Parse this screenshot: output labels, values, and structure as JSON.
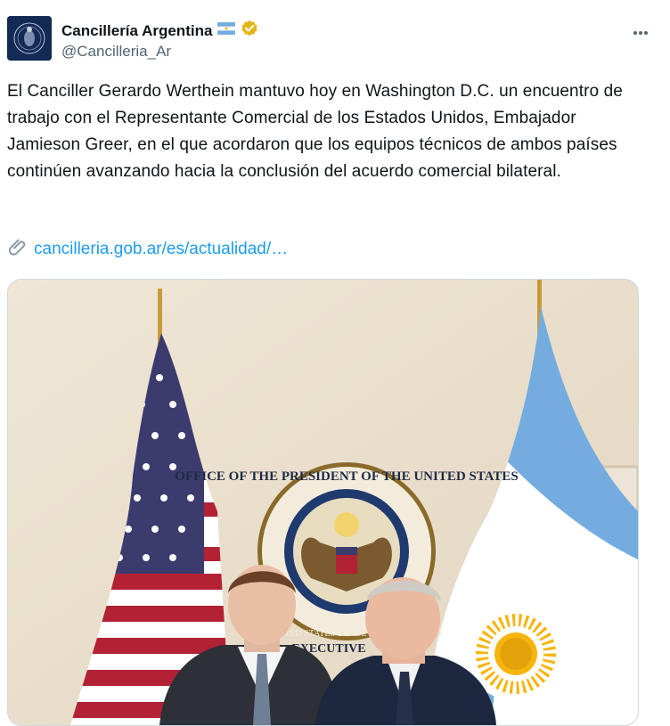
{
  "account": {
    "display_name": "Cancillería Argentina",
    "handle": "@Cancilleria_Ar",
    "flag_icon": "argentina-flag-icon",
    "verified_icon": "gold-verified-badge-icon",
    "verified_color": "#e2b719"
  },
  "tweet": {
    "text": "El Canciller Gerardo Werthein mantuvo hoy en Washington D.C. un encuentro de trabajo con el Representante Comercial de los Estados Unidos, Embajador Jamieson Greer, en el que acordaron que los equipos técnicos de ambos países continúen avanzando hacia la conclusión del acuerdo comercial bilateral.",
    "link_icon": "paperclip-icon",
    "link": "cancilleria.gob.ar/es/actualidad/…"
  },
  "photo": {
    "seal_top_text": "OFFICE OF THE PRESIDENT OF THE UNITED STATES",
    "seal_inner_text": "THE UNITED STATES TRADE REPRESENTATIVE",
    "seal_bottom_text": "EXECUTIVE"
  },
  "colors": {
    "link": "#1d9bf0",
    "secondary_text": "#536471",
    "argentina_blue": "#74acdf",
    "argentina_sun": "#f6b40e",
    "us_red": "#b22234",
    "us_blue": "#3c3b6e"
  }
}
